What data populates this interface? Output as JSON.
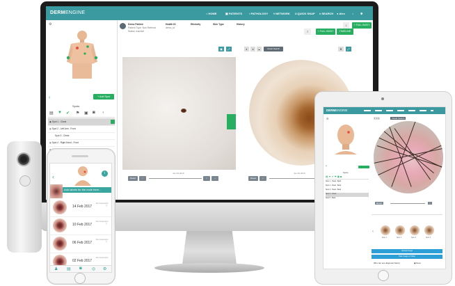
{
  "imac": {
    "nav": {
      "logo_bold": "DERM",
      "logo_thin": "ENGINE",
      "items": [
        "HOME",
        "PATIENTS",
        "PATHOLOGY",
        "NETWORK",
        "QUICK SNAP",
        "SEARCH",
        "Alex"
      ]
    },
    "left_panel": {
      "add_spot": "+ Add Spot",
      "spots_title": "Spots",
      "spots": [
        "Spot 1 - Chest",
        "Spot 2 - Left Arm - Front",
        "Spot 3 - Chest",
        "Spot 4 - Right Hand - Front",
        "Spot 5 - Left Hand - Back",
        "Spot 6 - Left Shoulder - Back"
      ]
    },
    "patient": {
      "name_label": "Demo Patient",
      "line2": "Patient Type: Non Referral",
      "line3": "Status: Inactive",
      "health_id_label": "Health ID",
      "health_id_value": "demo_id",
      "ethnicity_label": "Ethnicity",
      "skin_type_label": "Skin Type",
      "history_label": "History",
      "full_body_btn": "+ FULL BODY",
      "timeline_btn": "TIMELINE"
    },
    "viewer": {
      "visual_search": "Visual Search",
      "left_caption": "Jan 09 2018",
      "right_caption": "Jan 09 2018",
      "reset": "Reset"
    }
  },
  "iphone": {
    "banner": "Add labels for the mole here...",
    "dates": [
      "14 Feb 2017",
      "10 Feb 2017",
      "06 Feb 2017",
      "02 Feb 2017"
    ],
    "row_sub": "Dermoscopic"
  },
  "ipad": {
    "logo_bold": "DERM",
    "logo_thin": "ENGINE",
    "visual_search": "Visual Search",
    "spots_title": "Spots",
    "spots": [
      "Spot 1 - Head - Back",
      "Spot 2 - Head - Back",
      "Spot 3 - Head - Back",
      "Spot 4 - Chest",
      "Spot 5 - Back"
    ],
    "reset": "Reset",
    "thumb_labels": [
      "Spot 1",
      "Spot 2",
      "Spot 3",
      "Spot 4"
    ],
    "btn1": "Upload Image",
    "btn2": "Take Image or Video",
    "question": "Who can see diagnosis history",
    "answer": "None"
  },
  "colors": {
    "teal": "#3a9aa0",
    "green": "#27ae60",
    "blue": "#2b9fd6"
  }
}
